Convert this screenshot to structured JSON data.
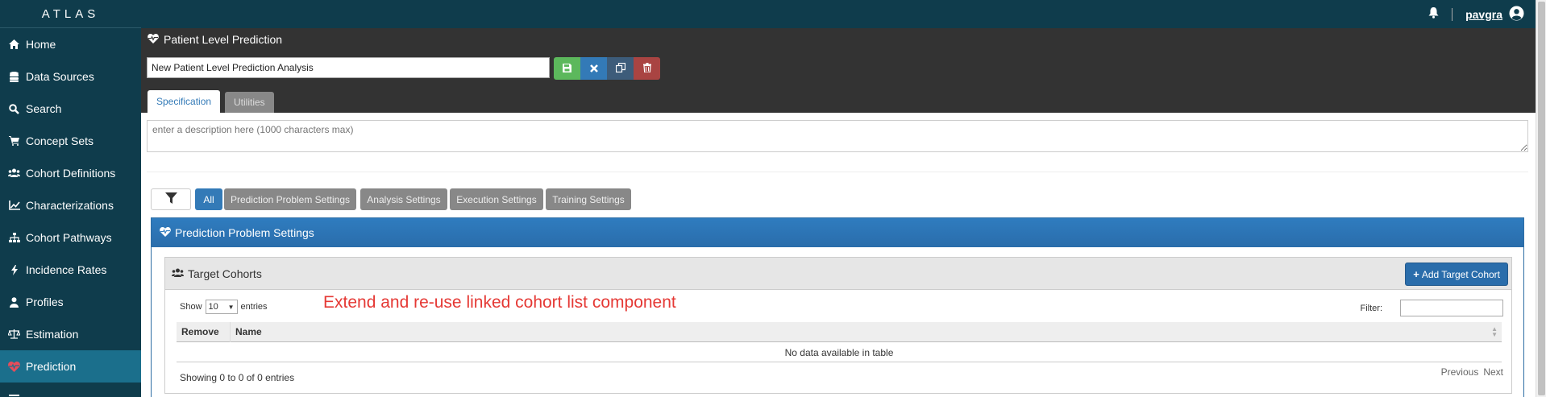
{
  "app": {
    "brand": "ATLAS"
  },
  "sidebar": {
    "items": [
      {
        "label": "Home",
        "icon": "home-icon"
      },
      {
        "label": "Data Sources",
        "icon": "database-icon"
      },
      {
        "label": "Search",
        "icon": "search-icon"
      },
      {
        "label": "Concept Sets",
        "icon": "cart-icon"
      },
      {
        "label": "Cohort Definitions",
        "icon": "users-icon"
      },
      {
        "label": "Characterizations",
        "icon": "line-chart-icon"
      },
      {
        "label": "Cohort Pathways",
        "icon": "sitemap-icon"
      },
      {
        "label": "Incidence Rates",
        "icon": "bolt-icon"
      },
      {
        "label": "Profiles",
        "icon": "user-icon"
      },
      {
        "label": "Estimation",
        "icon": "balance-scale-icon"
      },
      {
        "label": "Prediction",
        "icon": "heartbeat-icon",
        "active": true
      }
    ]
  },
  "topbar": {
    "username": "pavgra"
  },
  "header": {
    "title": "Patient Level Prediction",
    "analysis_name": "New Patient Level Prediction Analysis",
    "tabs": [
      {
        "label": "Specification"
      },
      {
        "label": "Utilities"
      }
    ]
  },
  "description": {
    "placeholder": "enter a description here (1000 characters max)"
  },
  "filters": {
    "buttons": [
      {
        "label": "All",
        "active": true
      },
      {
        "label": "Prediction Problem Settings"
      },
      {
        "label": "Analysis Settings"
      },
      {
        "label": "Execution Settings"
      },
      {
        "label": "Training Settings"
      }
    ]
  },
  "panel": {
    "title": "Prediction Problem Settings",
    "target": {
      "title": "Target Cohorts",
      "add_label": "Add Target Cohort",
      "annotation": "Extend and re-use linked cohort list component",
      "show_label": "Show",
      "entries_value": "10",
      "entries_label": "entries",
      "filter_label": "Filter:",
      "columns": [
        "Remove",
        "Name"
      ],
      "empty_text": "No data available in table",
      "info": "Showing 0 to 0 of 0 entries",
      "previous": "Previous",
      "next": "Next"
    }
  },
  "colors": {
    "sidebar": "#0f3c4c",
    "active": "#1b6f8c",
    "primary": "#337ab7",
    "annotation": "#e53935"
  }
}
